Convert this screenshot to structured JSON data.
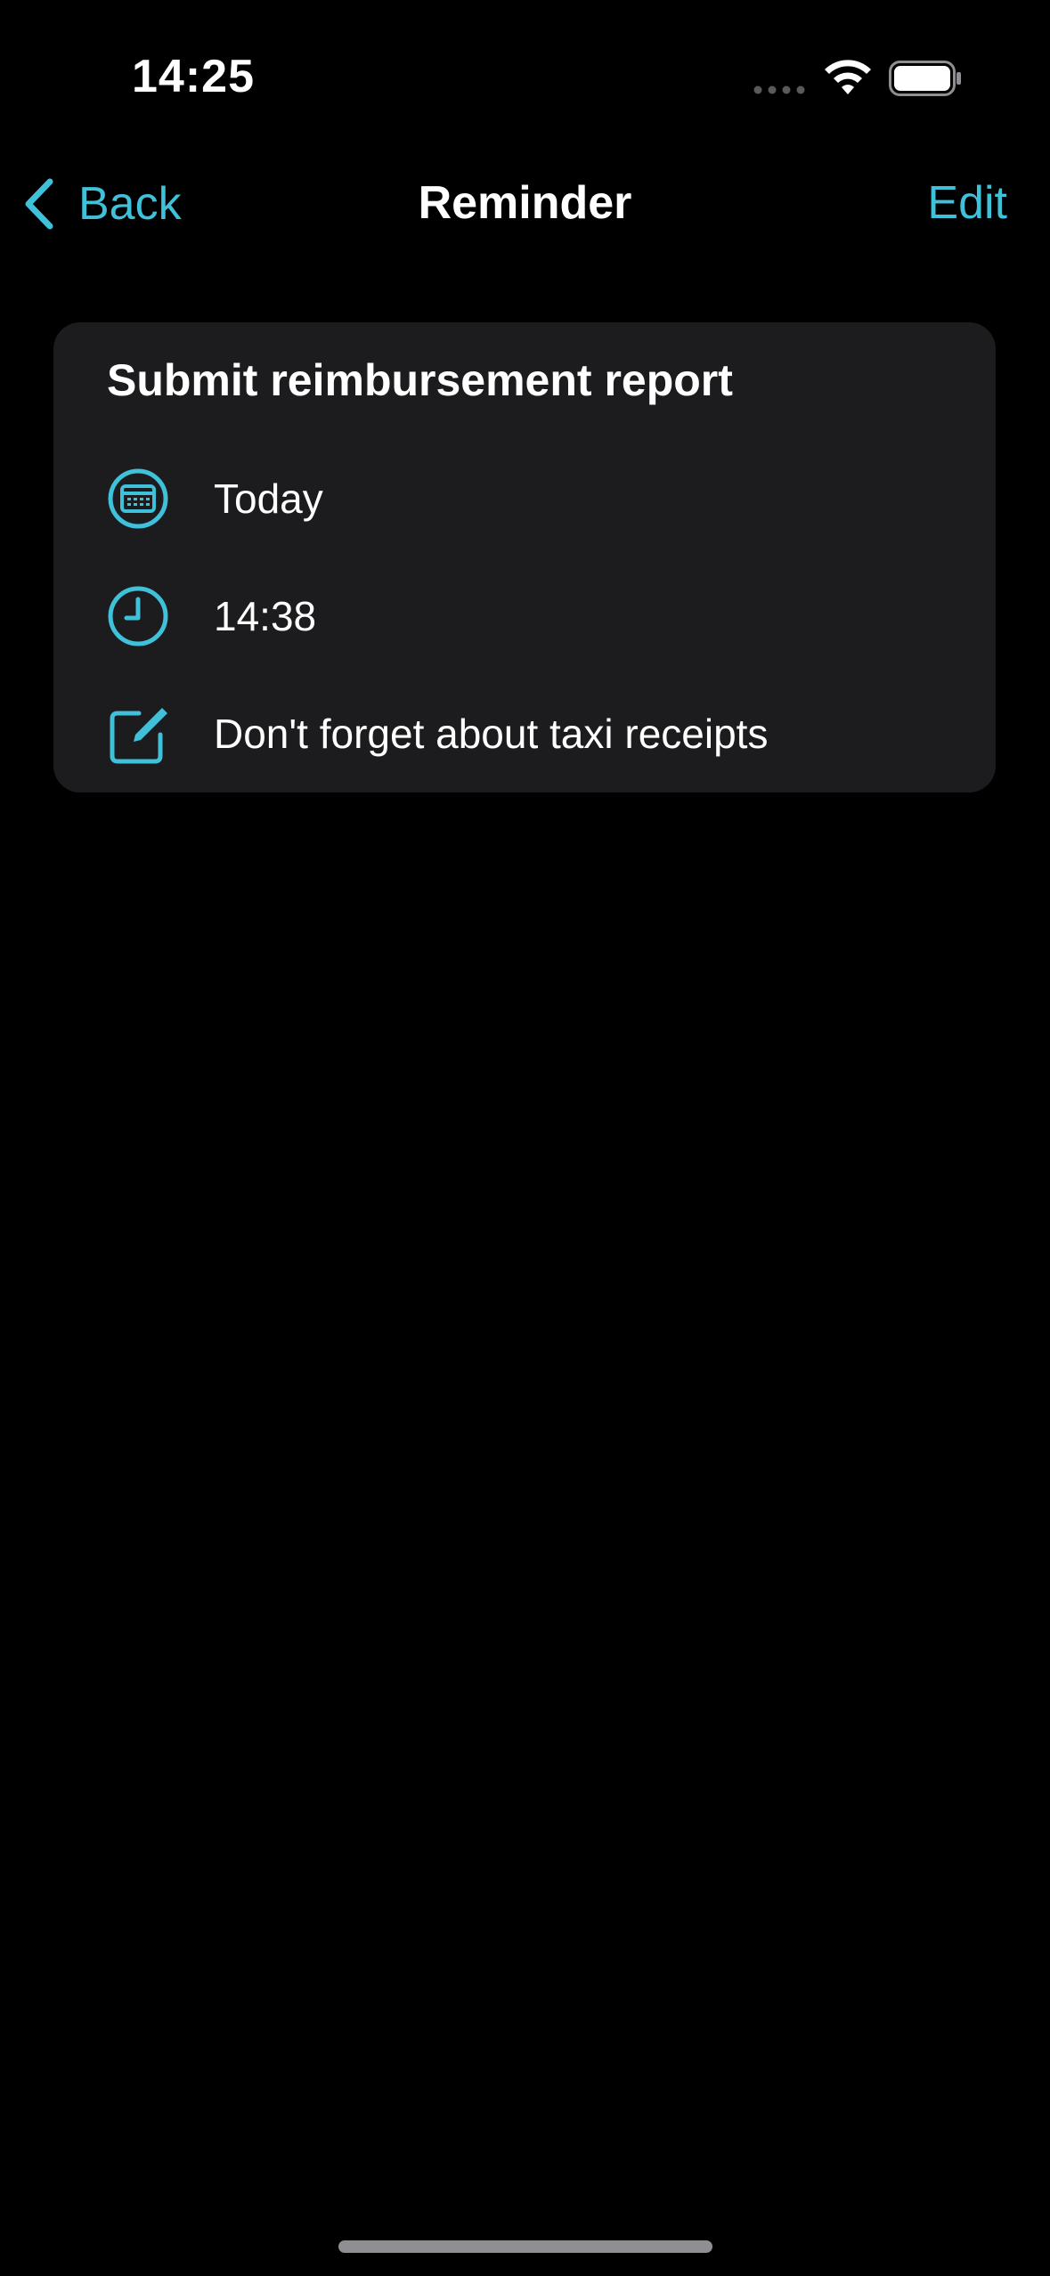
{
  "status_bar": {
    "time": "14:25",
    "icons": [
      "signal-dots-icon",
      "wifi-icon",
      "battery-icon"
    ]
  },
  "nav": {
    "back_label": "Back",
    "title": "Reminder",
    "edit_label": "Edit"
  },
  "reminder": {
    "title": "Submit reimbursement report",
    "date": "Today",
    "time": "14:38",
    "note": "Don't forget about taxi receipts"
  },
  "colors": {
    "background": "#000000",
    "card": "#1C1C1E",
    "accent": "#3FC1DA",
    "text": "#FFFFFF"
  }
}
